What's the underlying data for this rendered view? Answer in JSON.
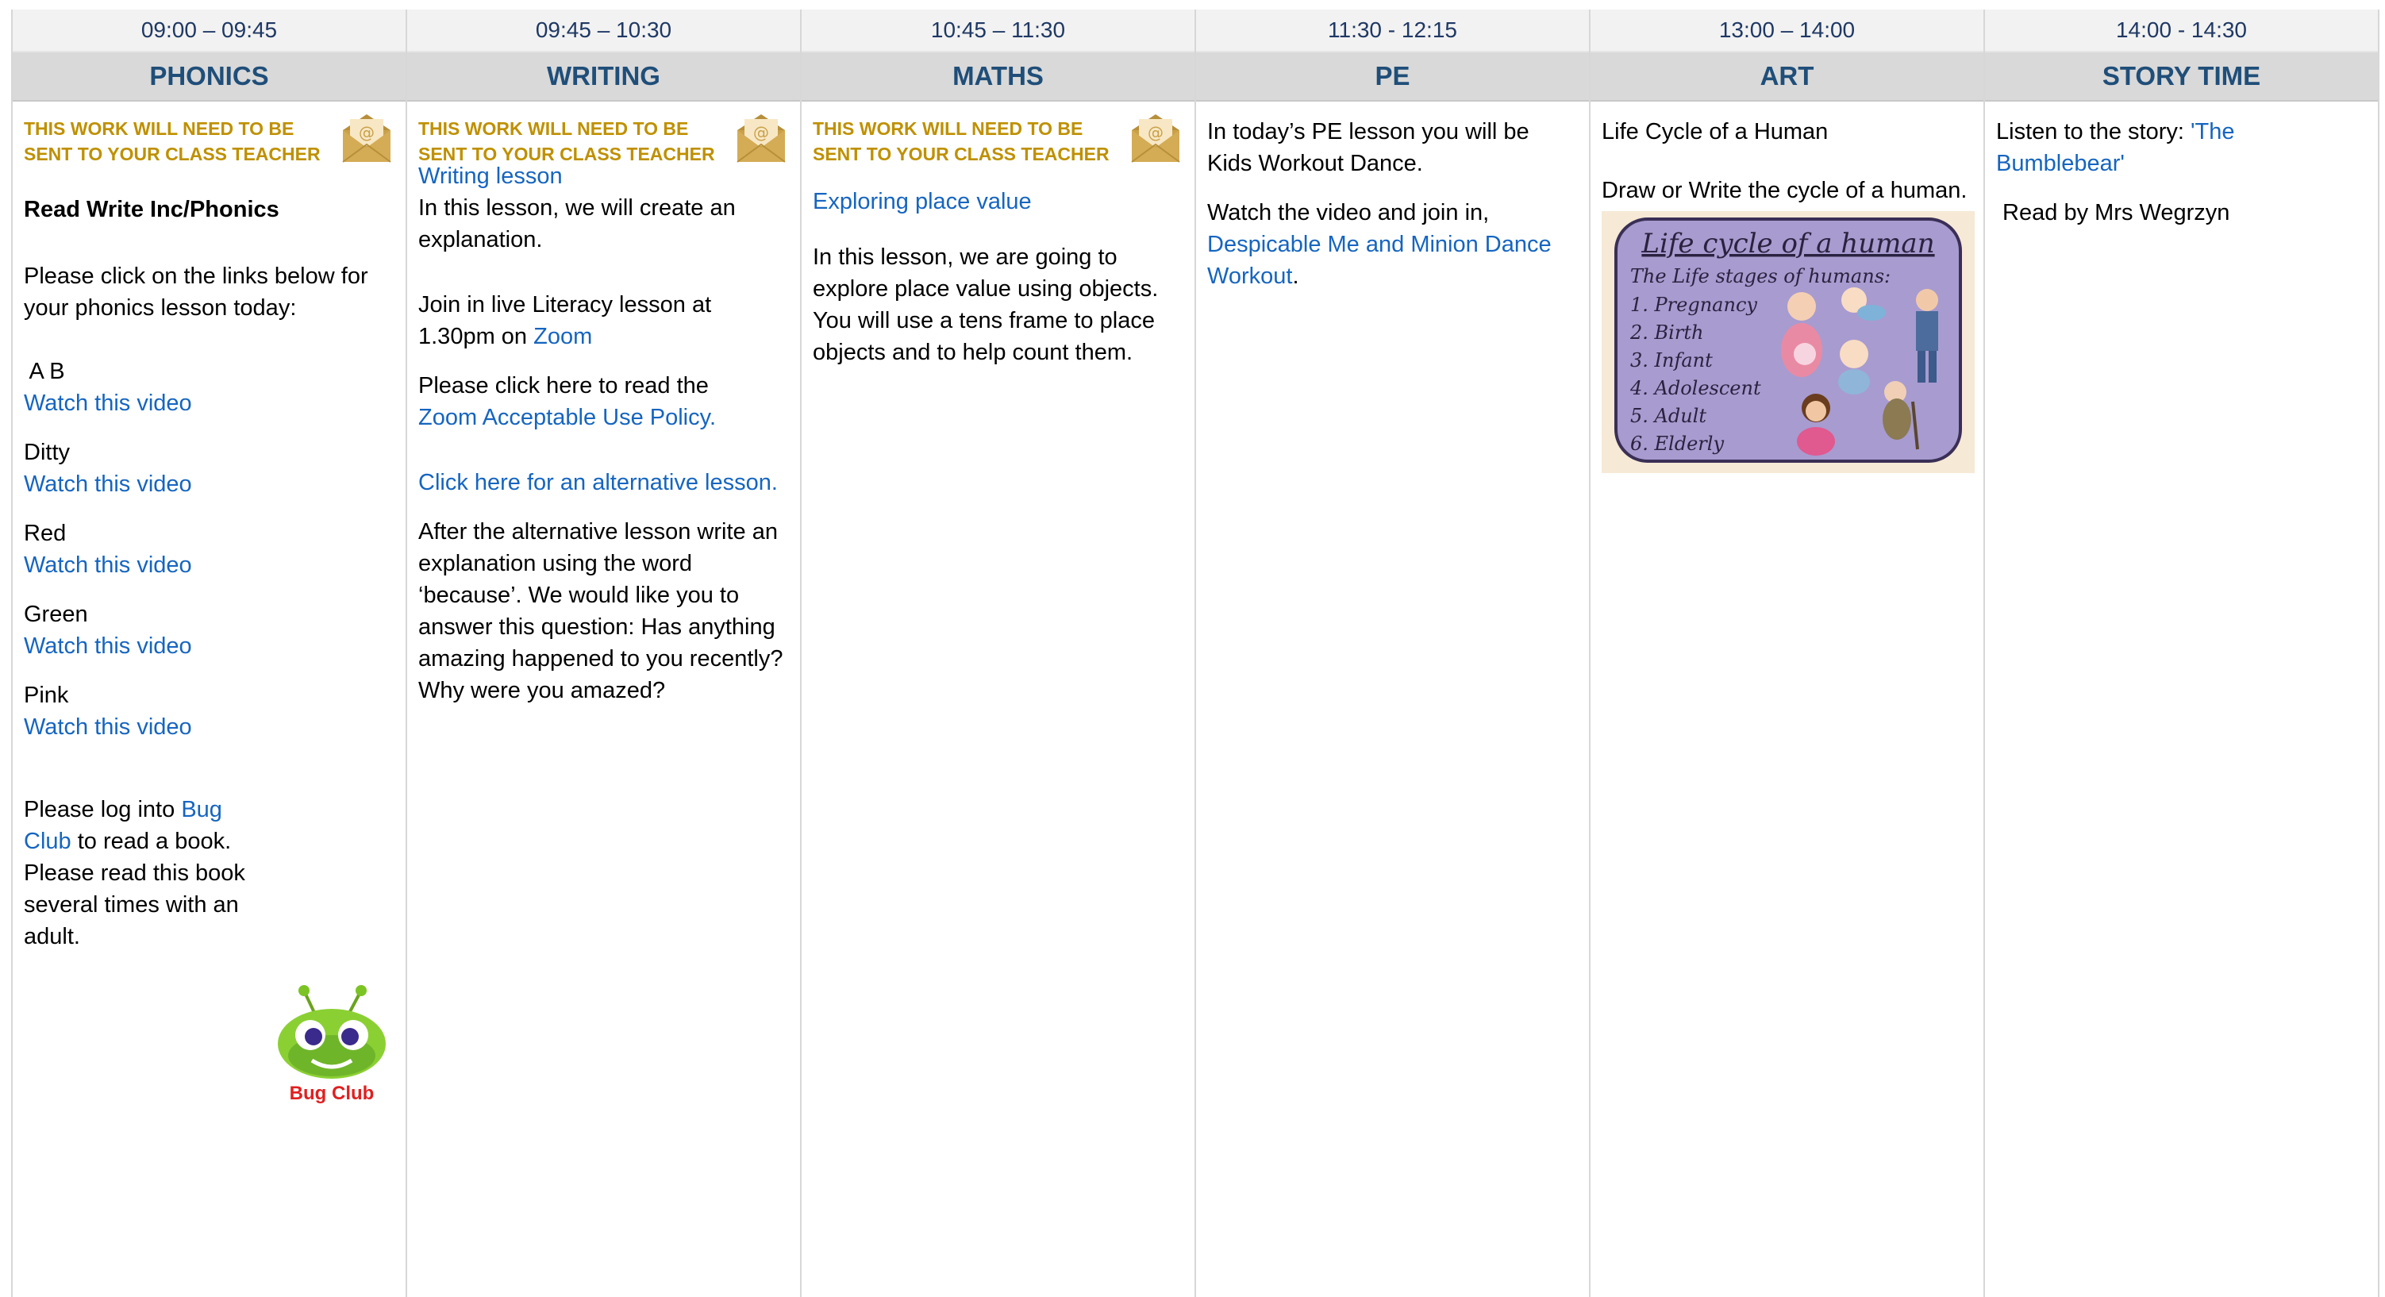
{
  "columns": [
    {
      "time": "09:00 – 09:45",
      "subject": "PHONICS"
    },
    {
      "time": "09:45 – 10:30",
      "subject": "WRITING"
    },
    {
      "time": "10:45 – 11:30",
      "subject": "MATHS"
    },
    {
      "time": "11:30 - 12:15",
      "subject": "PE"
    },
    {
      "time": "13:00 – 14:00",
      "subject": "ART"
    },
    {
      "time": "14:00 - 14:30",
      "subject": "STORY TIME"
    }
  ],
  "notice": {
    "line1": "THIS WORK WILL NEED TO BE",
    "line2": "SENT TO YOUR CLASS TEACHER",
    "icon": "email-envelope-icon"
  },
  "phonics": {
    "heading": "Read Write Inc/Phonics",
    "intro": "Please click on the links below for your phonics lesson today:",
    "items": [
      {
        "label": " A B",
        "link": "Watch this video"
      },
      {
        "label": "Ditty",
        "link": "Watch this video"
      },
      {
        "label": "Red",
        "link": "Watch this video"
      },
      {
        "label": "Green",
        "link": "Watch this video"
      },
      {
        "label": "Pink",
        "link": "Watch this video"
      }
    ],
    "bug_pre": "Please log into ",
    "bug_link": "Bug Club",
    "bug_post": " to read a book. Please read this book several times with an adult.",
    "logo_text": "Bug Club"
  },
  "writing": {
    "lesson_link": "Writing lesson",
    "intro": "In this lesson, we will create an explanation.",
    "live_pre": "Join in live Literacy lesson at 1.30pm on ",
    "live_link": "Zoom",
    "policy_pre": "Please click here to read the",
    "policy_link": "Zoom Acceptable Use Policy.",
    "alt_link": "Click here for an alternative lesson.",
    "after": "After the alternative lesson write an explanation using the word ‘because’. We would like you to answer this question: Has anything amazing happened to you recently? Why were you amazed?"
  },
  "maths": {
    "link": "Exploring place value",
    "text": "In this lesson, we are going to explore place value using objects. You will use a tens frame to place objects and to help count them."
  },
  "pe": {
    "intro": "In today’s PE lesson you will be Kids Workout Dance.",
    "watch": "Watch the video and join in,",
    "link": "Despicable Me and Minion Dance Workout",
    "end": "."
  },
  "art": {
    "title": "Life Cycle of a Human",
    "task": "Draw or Write the cycle of a human.",
    "image": {
      "title": "Life cycle of a human",
      "subtitle": "The Life stages of humans:",
      "stages": [
        "1.  Pregnancy",
        "2.  Birth",
        "3.  Infant",
        "4.  Adolescent",
        "5.  Adult",
        "6.  Elderly"
      ]
    }
  },
  "story": {
    "pre": "Listen to the story: ",
    "link": "'The Bumblebear'",
    "reader": " Read by Mrs Wegrzyn"
  },
  "colors": {
    "time_text": "#1f3864",
    "subject_text": "#1f4e79",
    "notice": "#bf9000",
    "link": "#1565c0"
  }
}
